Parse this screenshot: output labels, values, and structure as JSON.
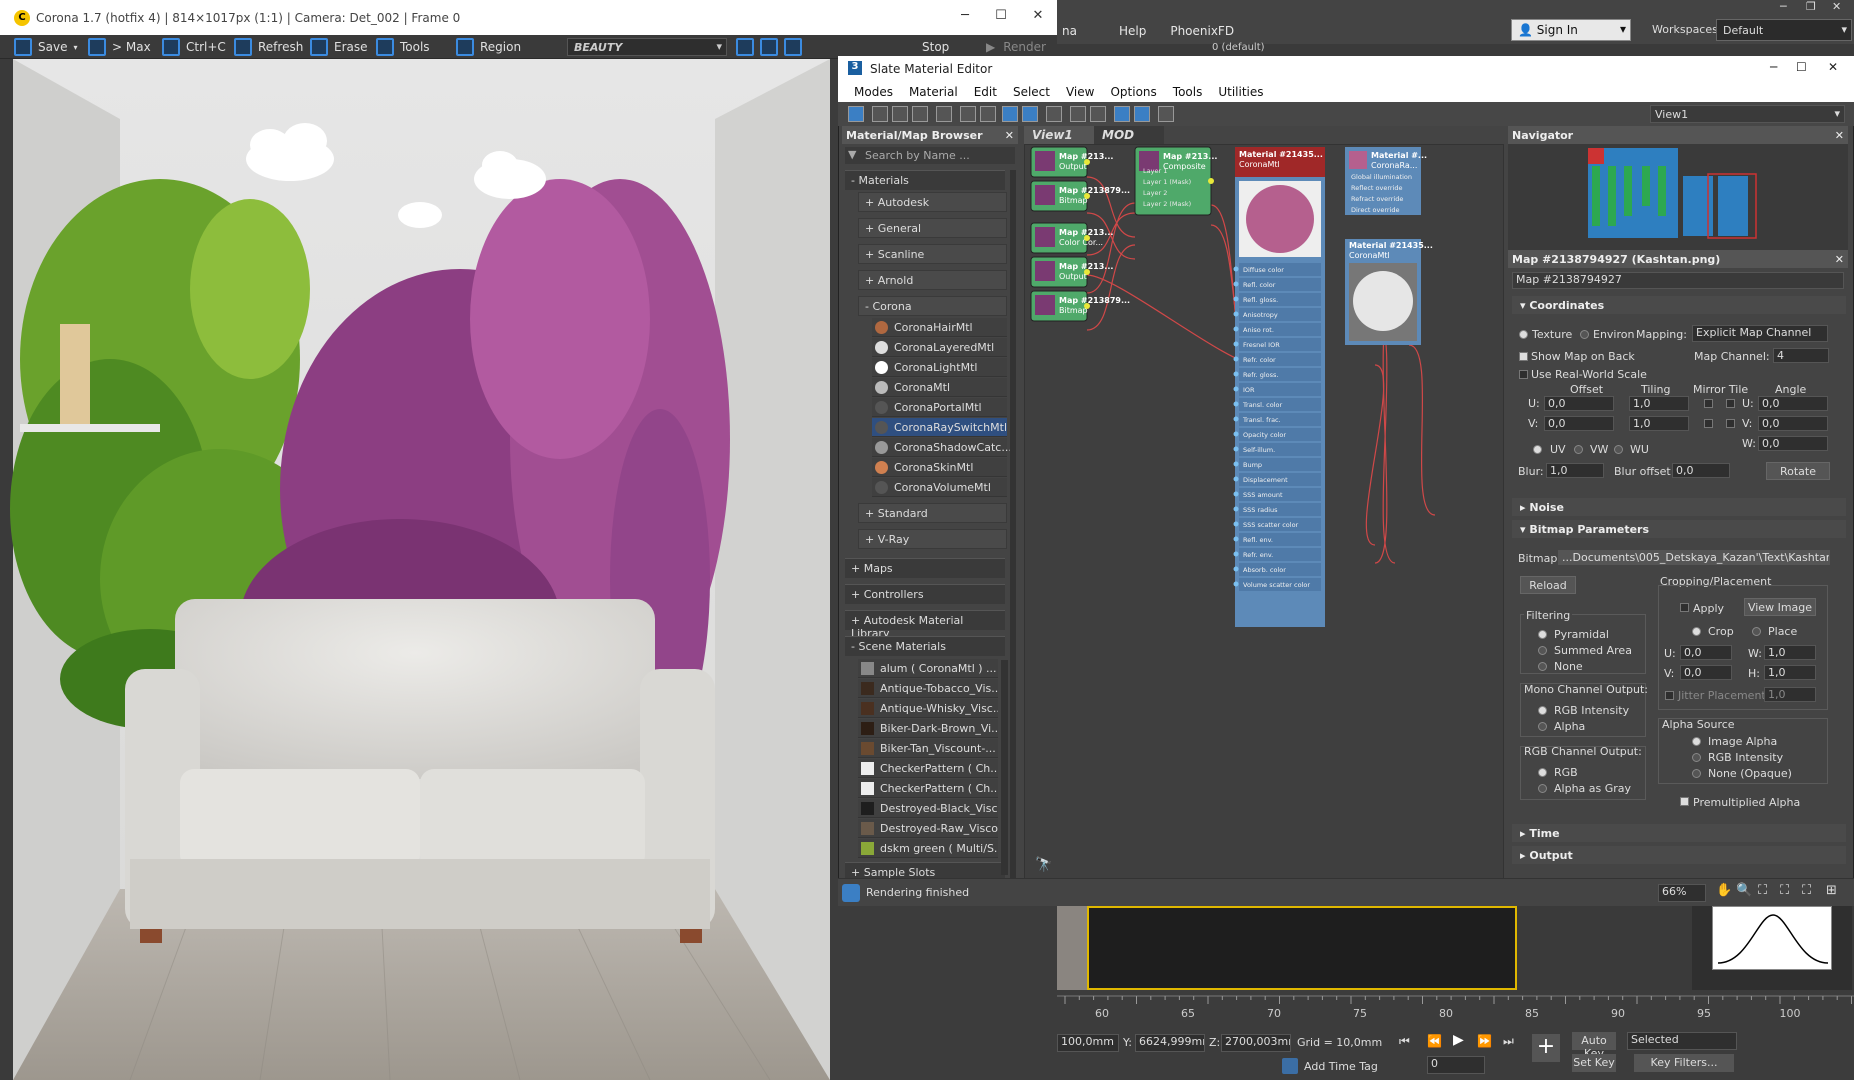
{
  "max": {
    "menu": [
      "na",
      "Help",
      "PhoenixFD"
    ],
    "sign_in": "Sign In",
    "workspaces_label": "Workspaces:",
    "workspaces_value": "Default",
    "viewport_layer": "0 (default)"
  },
  "vfb": {
    "title": "Corona 1.7 (hotfix 4) | 814×1017px (1:1) | Camera: Det_002 | Frame 0",
    "toolbar": {
      "save": "Save",
      "to_max": "> Max",
      "copy": "Ctrl+C",
      "refresh": "Refresh",
      "erase": "Erase",
      "tools": "Tools",
      "region": "Region",
      "stop": "Stop",
      "render": "Render",
      "channel": "BEAUTY"
    }
  },
  "slate": {
    "title": "Slate Material Editor",
    "menu": [
      "Modes",
      "Material",
      "Edit",
      "Select",
      "View",
      "Options",
      "Tools",
      "Utilities"
    ],
    "view_select": "View1",
    "browser": {
      "title": "Material/Map Browser",
      "search_placeholder": "Search by Name ...",
      "materials_label": "Materials",
      "groups": [
        "Autodesk",
        "General",
        "Scanline",
        "Arnold"
      ],
      "corona_label": "Corona",
      "corona_items": [
        "CoronaHairMtl",
        "CoronaLayeredMtl",
        "CoronaLightMtl",
        "CoronaMtl",
        "CoronaPortalMtl",
        "CoronaRaySwitchMtl",
        "CoronaShadowCatc...",
        "CoronaSkinMtl",
        "CoronaVolumeMtl"
      ],
      "groups2": [
        "Standard",
        "V-Ray"
      ],
      "maps": "Maps",
      "controllers": "Controllers",
      "adsk_lib": "Autodesk Material Library",
      "scene_materials": "Scene Materials",
      "scene_items": [
        "alum  ( CoronaMtl ) ...",
        "Antique-Tobacco_Vis...",
        "Antique-Whisky_Visc...",
        "Biker-Dark-Brown_Vi...",
        "Biker-Tan_Viscount-...",
        "CheckerPattern  ( Ch...",
        "CheckerPattern  ( Ch...",
        "Destroyed-Black_Visc...",
        "Destroyed-Raw_Visco...",
        "dskm green  ( Multi/S..."
      ],
      "sample_slots": "Sample Slots"
    },
    "view_tabs": [
      "View1",
      "MOD"
    ],
    "nodes": {
      "map1": {
        "t1": "Map #213...",
        "t2": "Output"
      },
      "map2": {
        "t1": "Map #213879...",
        "t2": "Bitmap"
      },
      "map3": {
        "t1": "Map #213...",
        "t2": "Color Cor..."
      },
      "map4": {
        "t1": "Map #213...",
        "t2": "Output"
      },
      "map5": {
        "t1": "Map #213879...",
        "t2": "Bitmap"
      },
      "composite": {
        "t1": "Map #213...",
        "t2": "Composite",
        "slots": [
          "Layer 1",
          "Layer 1 (Mask)",
          "Layer 2",
          "Layer 2 (Mask)"
        ]
      },
      "mtl": {
        "t1": "Material #21435...",
        "t2": "CoronaMtl",
        "slots": [
          "Diffuse color",
          "Refl. color",
          "Refl. gloss.",
          "Anisotropy",
          "Aniso rot.",
          "Fresnel IOR",
          "Refr. color",
          "Refr. gloss.",
          "IOR",
          "Transl. color",
          "Transl. frac.",
          "Opacity color",
          "Self-illum.",
          "Bump",
          "Displacement",
          "SSS amount",
          "SSS radius",
          "SSS scatter color",
          "Refl. env.",
          "Refr. env.",
          "Absorb. color",
          "Volume scatter color"
        ]
      },
      "rayswitch": {
        "t1": "Material #...",
        "t2": "CoronaRa...",
        "slots": [
          "Global illumination",
          "Reflect override",
          "Refract override",
          "Direct override"
        ]
      },
      "mtl2": {
        "t1": "Material #21435...",
        "t2": "CoronaMtl"
      }
    },
    "navigator": "Navigator",
    "param_title": "Map #2138794927 (Kashtan.png)",
    "map_name": "Map #2138794927",
    "coordinates": {
      "title": "Coordinates",
      "texture": "Texture",
      "environ": "Environ",
      "mapping_label": "Mapping:",
      "mapping": "Explicit Map Channel",
      "show_map": "Show Map on Back",
      "map_channel_label": "Map Channel:",
      "map_channel": "4",
      "real_world": "Use Real-World Scale",
      "offset": "Offset",
      "tiling": "Tiling",
      "mirror_tile": "Mirror Tile",
      "angle": "Angle",
      "u": "U:",
      "v": "V:",
      "w": "W:",
      "u_off": "0,0",
      "v_off": "0,0",
      "u_til": "1,0",
      "v_til": "1,0",
      "u_ang": "0,0",
      "v_ang": "0,0",
      "w_ang": "0,0",
      "uv": "UV",
      "vw": "VW",
      "wu": "WU",
      "blur_label": "Blur:",
      "blur": "1,0",
      "blur_off_label": "Blur offset:",
      "blur_off": "0,0",
      "rotate": "Rotate"
    },
    "noise": "Noise",
    "bitmap_params": {
      "title": "Bitmap Parameters",
      "bitmap_label": "Bitmap:",
      "bitmap_path": "...Documents\\005_Detskaya_Kazan'\\Text\\Kashtan.png",
      "reload": "Reload",
      "crop_title": "Cropping/Placement",
      "apply": "Apply",
      "view_image": "View Image",
      "crop": "Crop",
      "place": "Place",
      "filtering": "Filtering",
      "pyramidal": "Pyramidal",
      "summed": "Summed Area",
      "none": "None",
      "cu": "U:",
      "cu_v": "0,0",
      "cw": "W:",
      "cw_v": "1,0",
      "cv": "V:",
      "cv_v": "0,0",
      "ch": "H:",
      "ch_v": "1,0",
      "jitter": "Jitter Placement:",
      "jitter_v": "1,0",
      "mono": "Mono Channel Output:",
      "rgb_int": "RGB Intensity",
      "alpha": "Alpha",
      "alpha_src": "Alpha Source",
      "img_alpha": "Image Alpha",
      "rgb_int2": "RGB Intensity",
      "none_opaque": "None (Opaque)",
      "rgb_out": "RGB Channel Output:",
      "rgb": "RGB",
      "alpha_gray": "Alpha as Gray",
      "premult": "Premultiplied Alpha"
    },
    "time": "Time",
    "output": "Output",
    "status": "Rendering finished",
    "zoom": "66%"
  },
  "timeline": {
    "ticks": [
      "60",
      "65",
      "70",
      "75",
      "80",
      "85",
      "90",
      "95",
      "100"
    ]
  },
  "bottom": {
    "x": "100,0mm",
    "y_label": "Y:",
    "y": "6624,999mr",
    "z_label": "Z:",
    "z": "2700,003mr",
    "grid": "Grid = 10,0mm",
    "auto_key": "Auto Key",
    "set_key": "Set Key",
    "selected": "Selected",
    "key_filters": "Key Filters...",
    "frame": "0",
    "add_time_tag": "Add Time Tag"
  }
}
